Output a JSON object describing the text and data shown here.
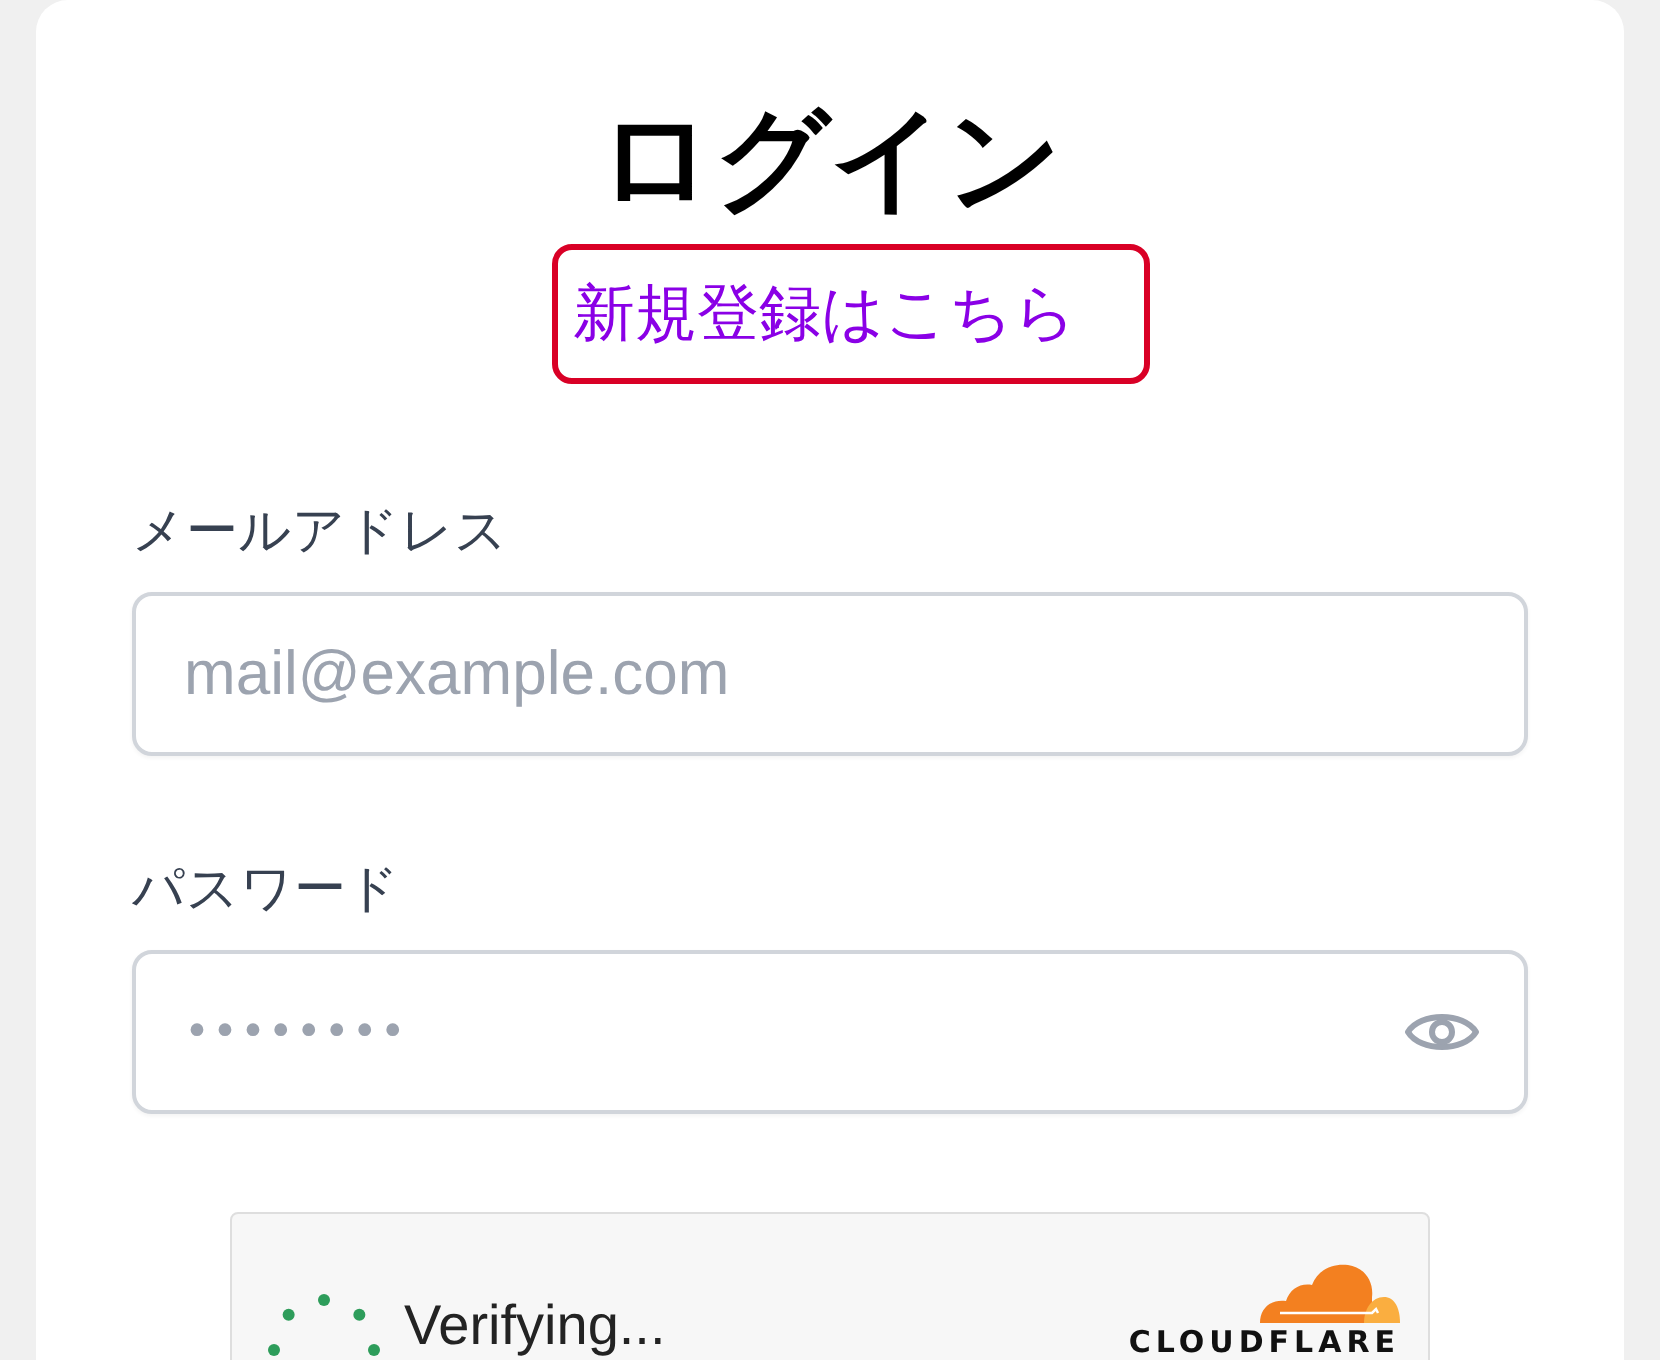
{
  "title": "ログイン",
  "register_link": {
    "text": "新規登録はこちら",
    "highlighted": true
  },
  "fields": [
    {
      "kind": "email",
      "label": "メールアドレス",
      "placeholder": "mail@example.com"
    },
    {
      "kind": "password",
      "label": "パスワード",
      "placeholder": "••••••••"
    }
  ],
  "captcha": {
    "status": "Verifying...",
    "brand": "CLOUDFLARE"
  }
}
